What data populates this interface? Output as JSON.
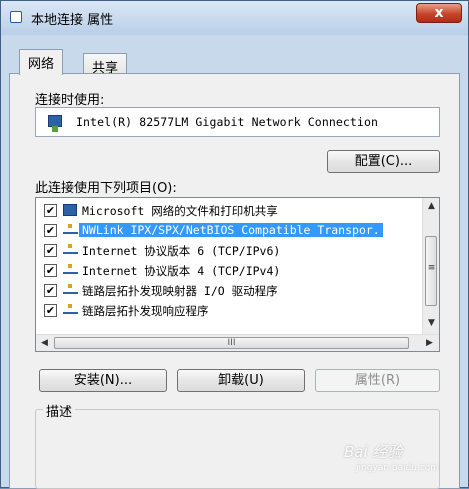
{
  "window": {
    "title": "本地连接 属性",
    "close_label": "x"
  },
  "tabs": [
    {
      "label": "网络"
    },
    {
      "label": "共享"
    }
  ],
  "connect_using": {
    "label": "连接时使用:",
    "adapter": "Intel(R) 82577LM Gigabit Network Connection",
    "configure_label": "配置(C)..."
  },
  "components": {
    "label": "此连接使用下列项目(O):",
    "items": [
      {
        "text": "Microsoft 网络的文件和打印机共享",
        "checked": true,
        "icon": "network-client-icon"
      },
      {
        "text": "NWLink IPX/SPX/NetBIOS Compatible Transpor.",
        "checked": true,
        "icon": "protocol-icon",
        "selected": true
      },
      {
        "text": "Internet 协议版本 6 (TCP/IPv6)",
        "checked": true,
        "icon": "protocol-icon"
      },
      {
        "text": "Internet 协议版本 4 (TCP/IPv4)",
        "checked": true,
        "icon": "protocol-icon"
      },
      {
        "text": "链路层拓扑发现映射器 I/O 驱动程序",
        "checked": true,
        "icon": "protocol-icon"
      },
      {
        "text": "链路层拓扑发现响应程序",
        "checked": true,
        "icon": "protocol-icon"
      }
    ],
    "check_mark": "✔",
    "scroll_up": "▲",
    "scroll_down": "▼",
    "scroll_left": "◀",
    "scroll_right": "▶",
    "grip": "≡",
    "hgrip": "III"
  },
  "buttons": {
    "install": "安装(N)...",
    "uninstall": "卸载(U)",
    "properties": "属性(R)"
  },
  "description": {
    "label": "描述"
  },
  "watermark": {
    "main": "Bai 经验",
    "sub": "jingyan.baidu.com"
  }
}
